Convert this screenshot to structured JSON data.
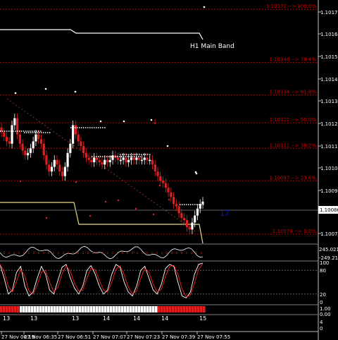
{
  "main_band_label": "H1 Main Band",
  "counter_label": "17",
  "fib_levels": [
    {
      "label": "1.10171 --> 100.0%",
      "price": 1.10171
    },
    {
      "label": "1.10148 --> 78.4%",
      "price": 1.10148
    },
    {
      "label": "1.10134 --> 61.8%",
      "price": 1.10134
    },
    {
      "label": "1.10122 --> 50.0%",
      "price": 1.10122
    },
    {
      "label": "1.10111 --> 38.2%",
      "price": 1.10111
    },
    {
      "label": "1.10097 --> 23.6%",
      "price": 1.10097
    },
    {
      "label": "1.10074 --> 0.0%",
      "price": 1.10074
    }
  ],
  "price_axis_ticks": [
    "1.10171",
    "1.10165",
    "1.10155",
    "1.10145",
    "1.10135",
    "1.10125",
    "1.10115",
    "1.10105",
    "1.10095",
    "1.10075"
  ],
  "current_price": "1.10086",
  "osc_upper": "245.021",
  "osc_lower": "-249.213",
  "stoch_ticks": [
    "100",
    "80",
    "20",
    "0"
  ],
  "bar_indicator_ticks": [
    "1.00",
    "0.00"
  ],
  "bottom_ticks": [
    "4",
    "0"
  ],
  "time_labels": [
    "13",
    "27 Nov 06:19",
    "13",
    "27 Nov 06:35",
    "27 Nov 06:51",
    "27 Nov 07:07",
    "27 Nov 07:23",
    "27 Nov 07:39",
    "27 Nov 07:55"
  ],
  "x_axis_left_labels": [
    "13",
    "13",
    "13",
    "14",
    "14",
    "14",
    "15"
  ],
  "colors": {
    "background": "#000000",
    "fib_line": "#c00000",
    "fib_text": "#d00000",
    "band_white": "#ffffff",
    "band_khaki": "#e8d88a",
    "candle_red": "#e02020",
    "candle_white": "#ffffff",
    "counter_blue": "#1010d0",
    "stoch_red": "#ff2020"
  },
  "chart_data": {
    "type": "candlestick",
    "title": "",
    "y_range": [
      1.1007,
      1.10175
    ],
    "x_time_labels": [
      "27 Nov 06:19",
      "27 Nov 06:35",
      "27 Nov 06:51",
      "27 Nov 07:07",
      "27 Nov 07:23",
      "27 Nov 07:39",
      "27 Nov 07:55"
    ],
    "fib_levels": [
      1.10171,
      1.10148,
      1.10134,
      1.10122,
      1.10111,
      1.10097,
      1.10074
    ],
    "current_price": 1.10086,
    "stochastic_range": [
      0,
      100
    ],
    "oscillator_range": [
      -249.213,
      245.021
    ]
  }
}
